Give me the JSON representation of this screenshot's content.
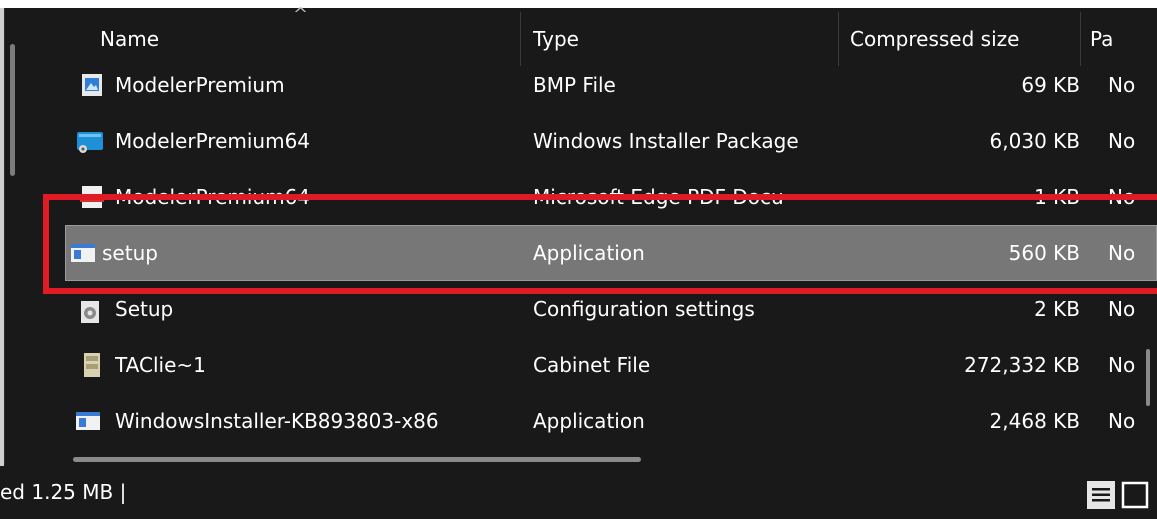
{
  "columns": {
    "name": "Name",
    "type": "Type",
    "compressed_size": "Compressed size",
    "password": "Pa"
  },
  "rows": [
    {
      "name": "ModelerPremium",
      "type": "BMP File",
      "size": "69 KB",
      "extra": "No",
      "icon": "bmp-file-icon"
    },
    {
      "name": "ModelerPremium64",
      "type": "Windows Installer Package",
      "size": "6,030 KB",
      "extra": "No",
      "icon": "windows-installer-icon"
    },
    {
      "name": "ModelerPremium64",
      "type": "Microsoft Edge PDF Docu",
      "size": "1 KB",
      "extra": "No",
      "icon": "pdf-file-icon"
    },
    {
      "name": "setup",
      "type": "Application",
      "size": "560 KB",
      "extra": "No",
      "icon": "application-icon"
    },
    {
      "name": "Setup",
      "type": "Configuration settings",
      "size": "2 KB",
      "extra": "No",
      "icon": "settings-file-icon"
    },
    {
      "name": "TAClie~1",
      "type": "Cabinet File",
      "size": "272,332 KB",
      "extra": "No",
      "icon": "cabinet-file-icon"
    },
    {
      "name": "WindowsInstaller-KB893803-x86",
      "type": "Application",
      "size": "2,468 KB",
      "extra": "No",
      "icon": "application-icon"
    }
  ],
  "selected_row": 3,
  "status": {
    "text": "ed  1.25 MB  |"
  },
  "colors": {
    "background": "#191919",
    "selection": "#777777",
    "highlight_box": "#e01b24",
    "text": "#ffffff"
  }
}
